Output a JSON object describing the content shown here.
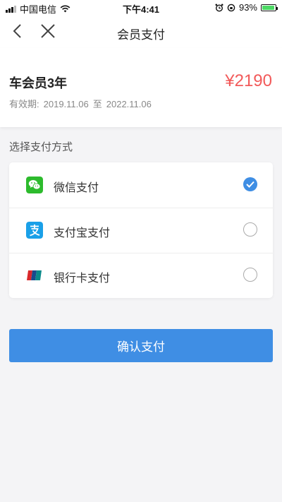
{
  "status_bar": {
    "carrier": "中国电信",
    "time": "下午4:41",
    "battery": "93%"
  },
  "nav": {
    "title": "会员支付",
    "back_icon": "chevron-left-icon",
    "close_icon": "close-icon"
  },
  "order": {
    "product_name": "车会员3年",
    "price": "¥2190",
    "validity_label": "有效期:",
    "start_date": "2019.11.06",
    "to_text": "至",
    "end_date": "2022.11.06"
  },
  "payment": {
    "section_label": "选择支付方式",
    "methods": [
      {
        "label": "微信支付",
        "icon": "wechat-icon",
        "selected": true
      },
      {
        "label": "支付宝支付",
        "icon": "alipay-icon",
        "selected": false
      },
      {
        "label": "银行卡支付",
        "icon": "unionpay-icon",
        "selected": false
      }
    ]
  },
  "confirm_label": "确认支付",
  "colors": {
    "accent": "#3f8ee4",
    "price": "#f25a5a",
    "wechat": "#2dbb2d",
    "alipay": "#1aa0e8"
  }
}
